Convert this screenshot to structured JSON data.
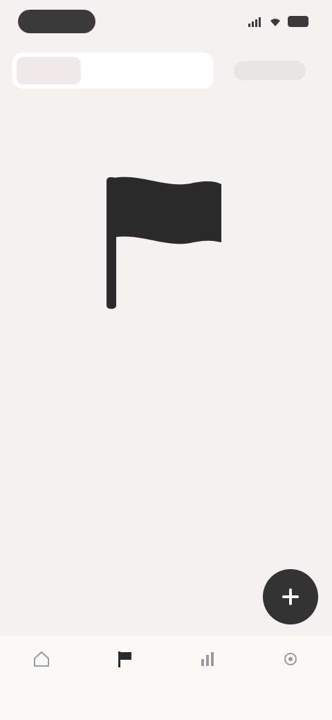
{
  "status_bar": {
    "time": "",
    "signal_icon": "signal-icon",
    "wifi_icon": "wifi-icon",
    "battery_icon": "battery-icon"
  },
  "header": {
    "tabs": [
      {
        "label": ""
      },
      {
        "label": ""
      },
      {
        "label": ""
      }
    ],
    "action_label": ""
  },
  "empty_state": {
    "icon": "flag-icon",
    "title": "",
    "subtitle": ""
  },
  "fab": {
    "icon": "plus-icon"
  },
  "bottom_nav": {
    "items": [
      {
        "label": "",
        "icon": "home-icon"
      },
      {
        "label": "",
        "icon": "flag-icon"
      },
      {
        "label": "",
        "icon": "stats-icon"
      },
      {
        "label": "",
        "icon": "settings-icon"
      }
    ]
  },
  "colors": {
    "background": "#f5f1f0",
    "primary_dark": "#333333",
    "surface": "#ffffff"
  }
}
